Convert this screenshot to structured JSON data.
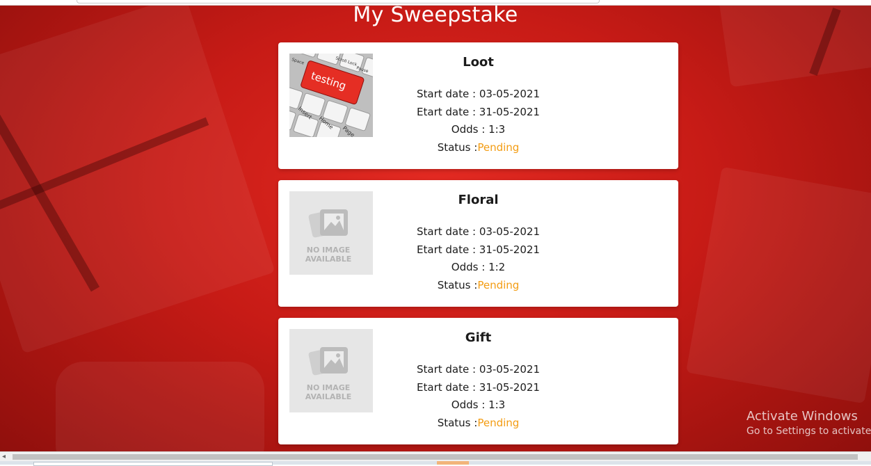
{
  "page": {
    "title": "My Sweepstake"
  },
  "labels": {
    "start_date": "Start date : ",
    "end_date": "Etart date : ",
    "odds": "Odds : ",
    "status": "Status :"
  },
  "cards": [
    {
      "name": "Loot",
      "image": "testing-keyboard-photo",
      "start_date": "03-05-2021",
      "end_date": "31-05-2021",
      "odds": "1:3",
      "status": "Pending"
    },
    {
      "name": "Floral",
      "image": "no-image-placeholder",
      "placeholder_line1": "NO IMAGE",
      "placeholder_line2": "AVAILABLE",
      "start_date": "03-05-2021",
      "end_date": "31-05-2021",
      "odds": "1:2",
      "status": "Pending"
    },
    {
      "name": "Gift",
      "image": "no-image-placeholder",
      "placeholder_line1": "NO IMAGE",
      "placeholder_line2": "AVAILABLE",
      "start_date": "03-05-2021",
      "end_date": "31-05-2021",
      "odds": "1:3",
      "status": "Pending"
    }
  ],
  "loot_image_text": {
    "keys": [
      "Space",
      "Scroll Lock",
      "Pause",
      "Insert",
      "Home",
      "Page"
    ],
    "highlight": "testing"
  },
  "watermark": {
    "line1": "Activate Windows",
    "line2": "Go to Settings to activate W"
  },
  "colors": {
    "background": "#c71b16",
    "status_pending": "#f39c12",
    "card": "#ffffff"
  }
}
